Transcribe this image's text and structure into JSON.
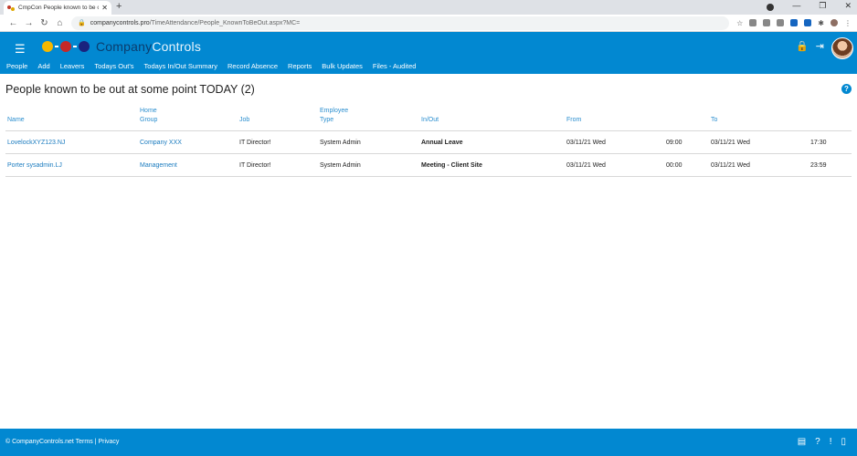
{
  "browser": {
    "tab_title": "CmpCon People known to be out",
    "new_tab": "+",
    "url_host": "companycontrols.pro",
    "url_path": "/TimeAttendance/People_KnownToBeOut.aspx?MC="
  },
  "app": {
    "brand_1": "Company",
    "brand_2": "Controls",
    "menu": [
      "People",
      "Add",
      "Leavers",
      "Todays Out's",
      "Todays In/Out Summary",
      "Record Absence",
      "Reports",
      "Bulk Updates",
      "Files - Audited"
    ]
  },
  "page": {
    "title": "People known to be out at some point TODAY (2)",
    "help": "?"
  },
  "table": {
    "headers": {
      "name": "Name",
      "home_group_1": "Home",
      "home_group_2": "Group",
      "job": "Job",
      "emp_type_1": "Employee",
      "emp_type_2": "Type",
      "in_out": "In/Out",
      "from": "From",
      "to": "To"
    },
    "rows": [
      {
        "name": "LovelockXYZ123.NJ",
        "group": "Company XXX",
        "job": "IT Director!",
        "type": "System Admin",
        "in_out": "Annual Leave",
        "from_date": "03/11/21 Wed",
        "from_time": "09:00",
        "to_date": "03/11/21 Wed",
        "to_time": "17:30"
      },
      {
        "name": "Porter sysadmin.LJ",
        "group": "Management",
        "job": "IT Director!",
        "type": "System Admin",
        "in_out": "Meeting - Client Site",
        "from_date": "03/11/21 Wed",
        "from_time": "00:00",
        "to_date": "03/11/21 Wed",
        "to_time": "23:59"
      }
    ]
  },
  "footer": {
    "copyright": "© CompanyControls.net",
    "terms": "Terms",
    "sep": "|",
    "privacy": "Privacy"
  },
  "colors": {
    "brand_blue": "#0288d1",
    "link": "#1a7bbf"
  }
}
